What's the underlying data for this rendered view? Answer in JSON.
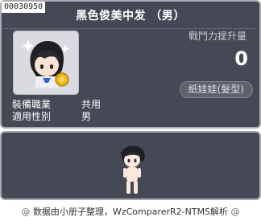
{
  "item": {
    "id": "00030950",
    "name": "黑色俊美中发 （男）",
    "power_label": "戰鬥力提升量",
    "power_value": "0",
    "type_badge": "紙娃娃(髮型)"
  },
  "info": {
    "job_label": "裝備職業",
    "job_value": "共用",
    "gender_label": "適用性別",
    "gender_value": "男"
  },
  "footer": {
    "credit": "数据由小册子整理，WzComparerR2-NTMS解析",
    "left_icon": "@",
    "right_icon": "@"
  },
  "colors": {
    "panel_bg": "#454955",
    "panel_border": "#a9acb3",
    "icon_bg": "#d9dbe0"
  }
}
